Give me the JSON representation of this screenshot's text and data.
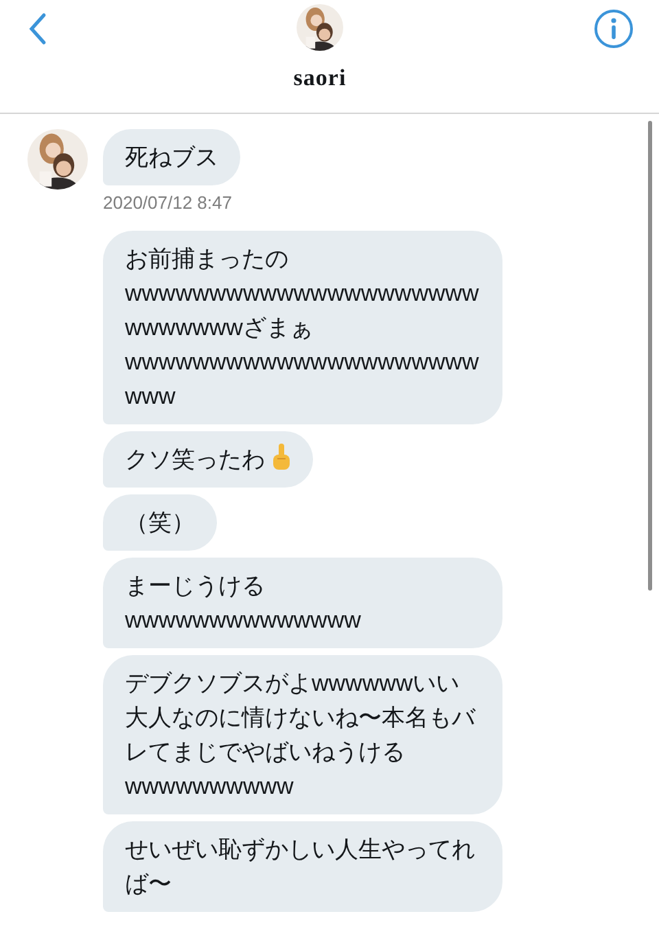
{
  "header": {
    "name": "saori"
  },
  "messages": [
    {
      "text": "死ねブス",
      "show_avatar": true,
      "timestamp": "2020/07/12 8:47",
      "has_emoji": false
    },
    {
      "text": "お前捕まったのwwwwwwwwwwwwwwwwwwwwwwwwwwwwざまぁwwwwwwwwwwwwwwwwwwwwwwww",
      "show_avatar": false,
      "has_emoji": false
    },
    {
      "text": "クソ笑ったわ",
      "show_avatar": false,
      "has_emoji": true
    },
    {
      "text": "（笑）",
      "show_avatar": false,
      "has_emoji": false
    },
    {
      "text": "まーじうけるwwwwwwwwwwwwww",
      "show_avatar": false,
      "has_emoji": false
    },
    {
      "text": "デブクソブスがよwwwwwwいい大人なのに情けないね〜本名もバレてまじでやばいねうけるwwwwwwwwww",
      "show_avatar": false,
      "has_emoji": false
    },
    {
      "text": "せいぜい恥ずかしい人生やってれば〜",
      "show_avatar": false,
      "has_emoji": false
    }
  ]
}
